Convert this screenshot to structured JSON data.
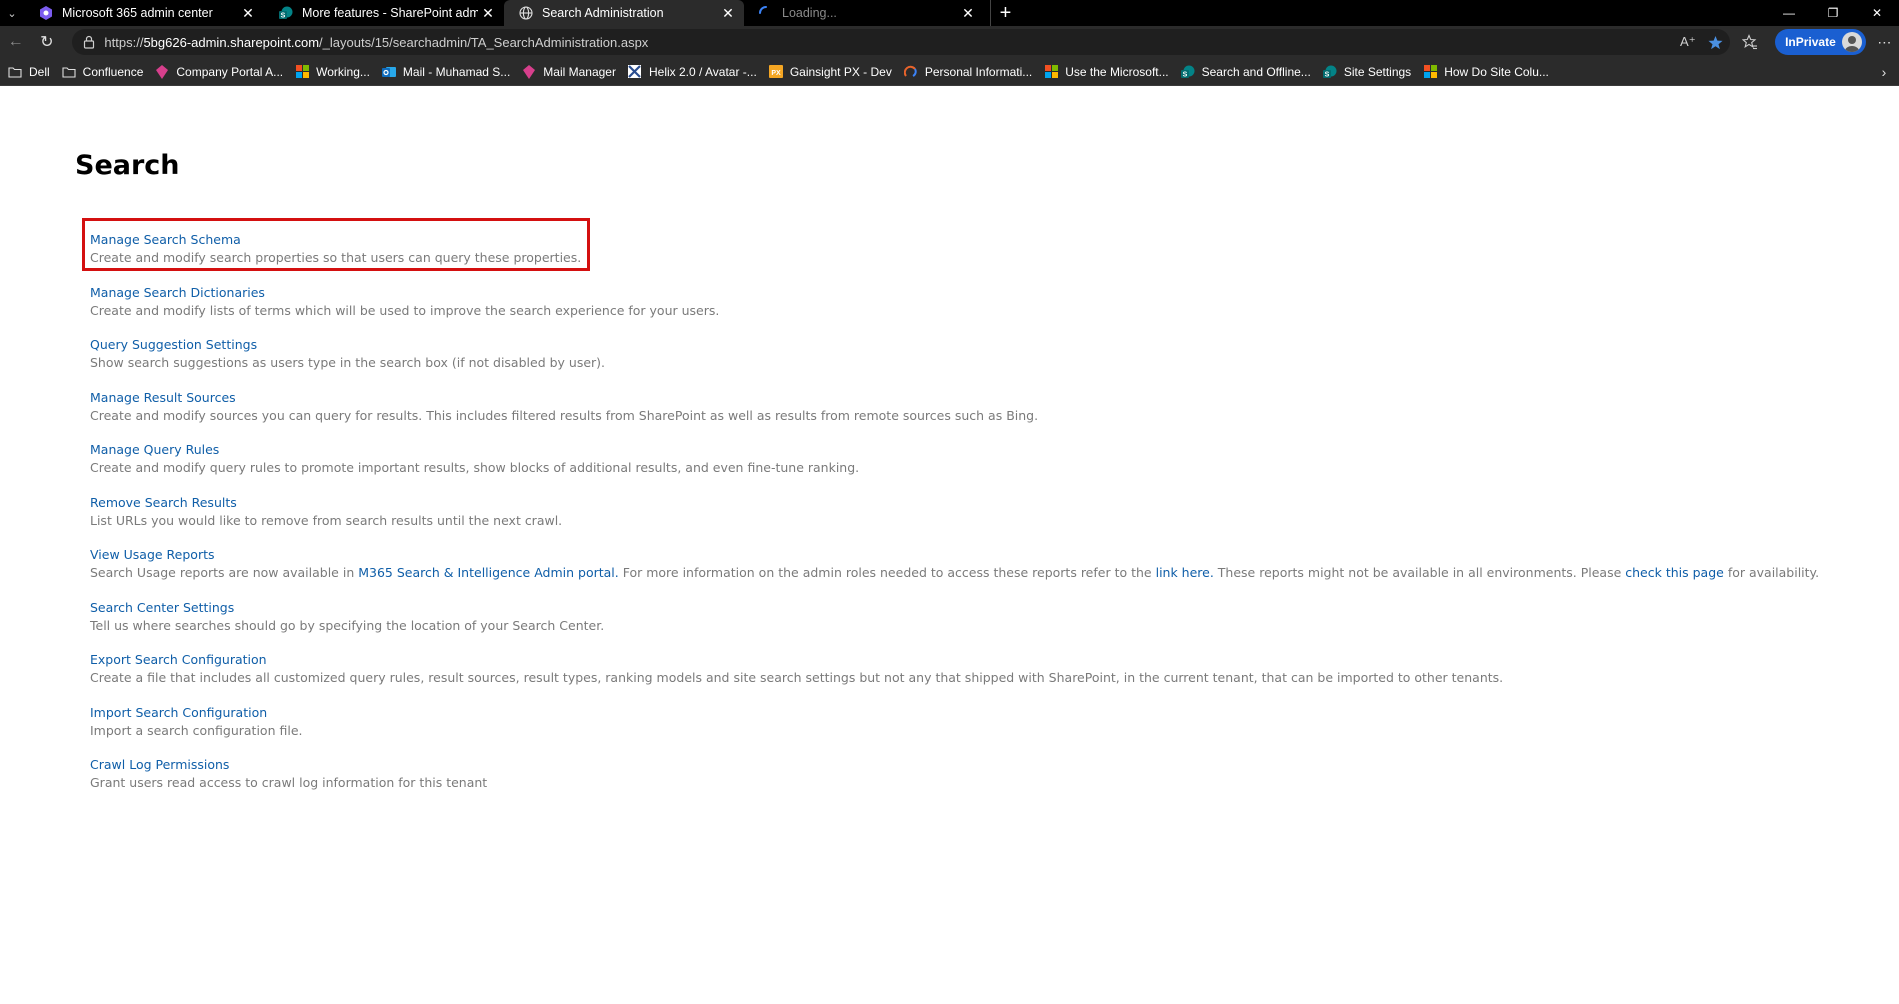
{
  "browser": {
    "tabs": [
      {
        "title": "Microsoft 365 admin center",
        "favicon": "m365-icon"
      },
      {
        "title": "More features - SharePoint admin",
        "favicon": "sharepoint-icon"
      },
      {
        "title": "Search Administration",
        "favicon": "globe-icon"
      },
      {
        "title": "Loading...",
        "favicon": "loading-spinner-icon"
      }
    ],
    "active_tab_index": 2,
    "url_prefix": "https://",
    "url_domain": "5bg626-admin.sharepoint.com",
    "url_path": "/_layouts/15/searchadmin/TA_SearchAdministration.aspx",
    "inprivate_label": "InPrivate",
    "favorites": [
      "Dell",
      "Confluence",
      "Company Portal A...",
      "Working...",
      "Mail - Muhamad S...",
      "Mail Manager",
      "Helix 2.0 / Avatar -...",
      "Gainsight PX - Dev",
      "Personal Informati...",
      "Use the Microsoft...",
      "Search and Offline...",
      "Site Settings",
      "How Do Site Colu..."
    ]
  },
  "page": {
    "title": "Search",
    "items": [
      {
        "title": "Manage Search Schema",
        "description": "Create and modify search properties so that users can query these properties."
      },
      {
        "title": "Manage Search Dictionaries",
        "description": "Create and modify lists of terms which will be used to improve the search experience for your users."
      },
      {
        "title": "Query Suggestion Settings",
        "description": "Show search suggestions as users type in the search box (if not disabled by user)."
      },
      {
        "title": "Manage Result Sources",
        "description": "Create and modify sources you can query for results. This includes filtered results from SharePoint as well as results from remote sources such as Bing."
      },
      {
        "title": "Manage Query Rules",
        "description": "Create and modify query rules to promote important results, show blocks of additional results, and even fine-tune ranking."
      },
      {
        "title": "Remove Search Results",
        "description": "List URLs you would like to remove from search results until the next crawl."
      },
      {
        "title": "View Usage Reports",
        "description": ""
      },
      {
        "title": "Search Center Settings",
        "description": "Tell us where searches should go by specifying the location of your Search Center."
      },
      {
        "title": "Export Search Configuration",
        "description": "Create a file that includes all customized query rules, result sources, result types, ranking models and site search settings but not any that shipped with SharePoint, in the current tenant, that can be imported to other tenants."
      },
      {
        "title": "Import Search Configuration",
        "description": "Import a search configuration file."
      },
      {
        "title": "Crawl Log Permissions",
        "description": "Grant users read access to crawl log information for this tenant"
      }
    ],
    "usage": {
      "part1": "Search Usage reports are now available in ",
      "link1": "M365 Search & Intelligence Admin portal.",
      "part2": " For more information on the admin roles needed to access these reports refer to the ",
      "link2": "link here.",
      "part3": " These reports might not be available in all environments. Please ",
      "link3": "check this page",
      "part4": " for availability."
    }
  },
  "colors": {
    "link": "#0f5ea8",
    "description": "#7a7a7a",
    "highlight_border": "#d41010",
    "inprivate": "#1a5fd1"
  }
}
